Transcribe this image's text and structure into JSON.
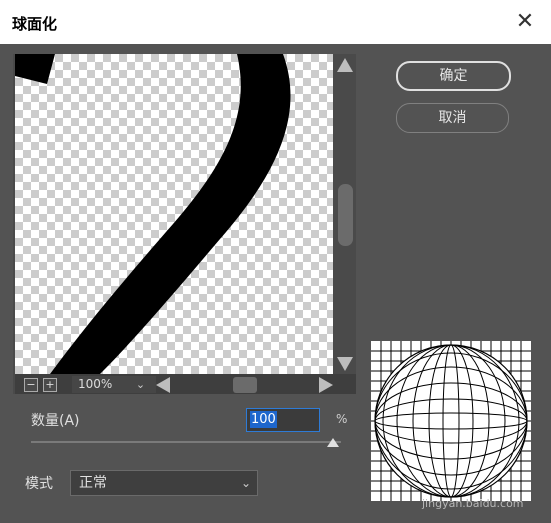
{
  "window": {
    "title": "球面化",
    "close_glyph": "✕"
  },
  "buttons": {
    "ok_label": "确定",
    "cancel_label": "取消"
  },
  "preview": {
    "zoom_out_glyph": "−",
    "zoom_in_glyph": "+",
    "zoom_value": "100%",
    "zoom_chevron": "⌄"
  },
  "amount": {
    "label": "数量(A)",
    "value": "100",
    "unit": "%",
    "slider_fraction": 1.0
  },
  "mode": {
    "label": "模式",
    "selected": "正常",
    "chevron": "⌄"
  },
  "watermark": "jingyan.baidu.com",
  "colors": {
    "dialog_bg": "#535353",
    "accent_blue": "#2e7bd6"
  },
  "icons": {
    "close": "close-icon",
    "zoom_out": "zoom-out-icon",
    "zoom_in": "zoom-in-icon"
  }
}
